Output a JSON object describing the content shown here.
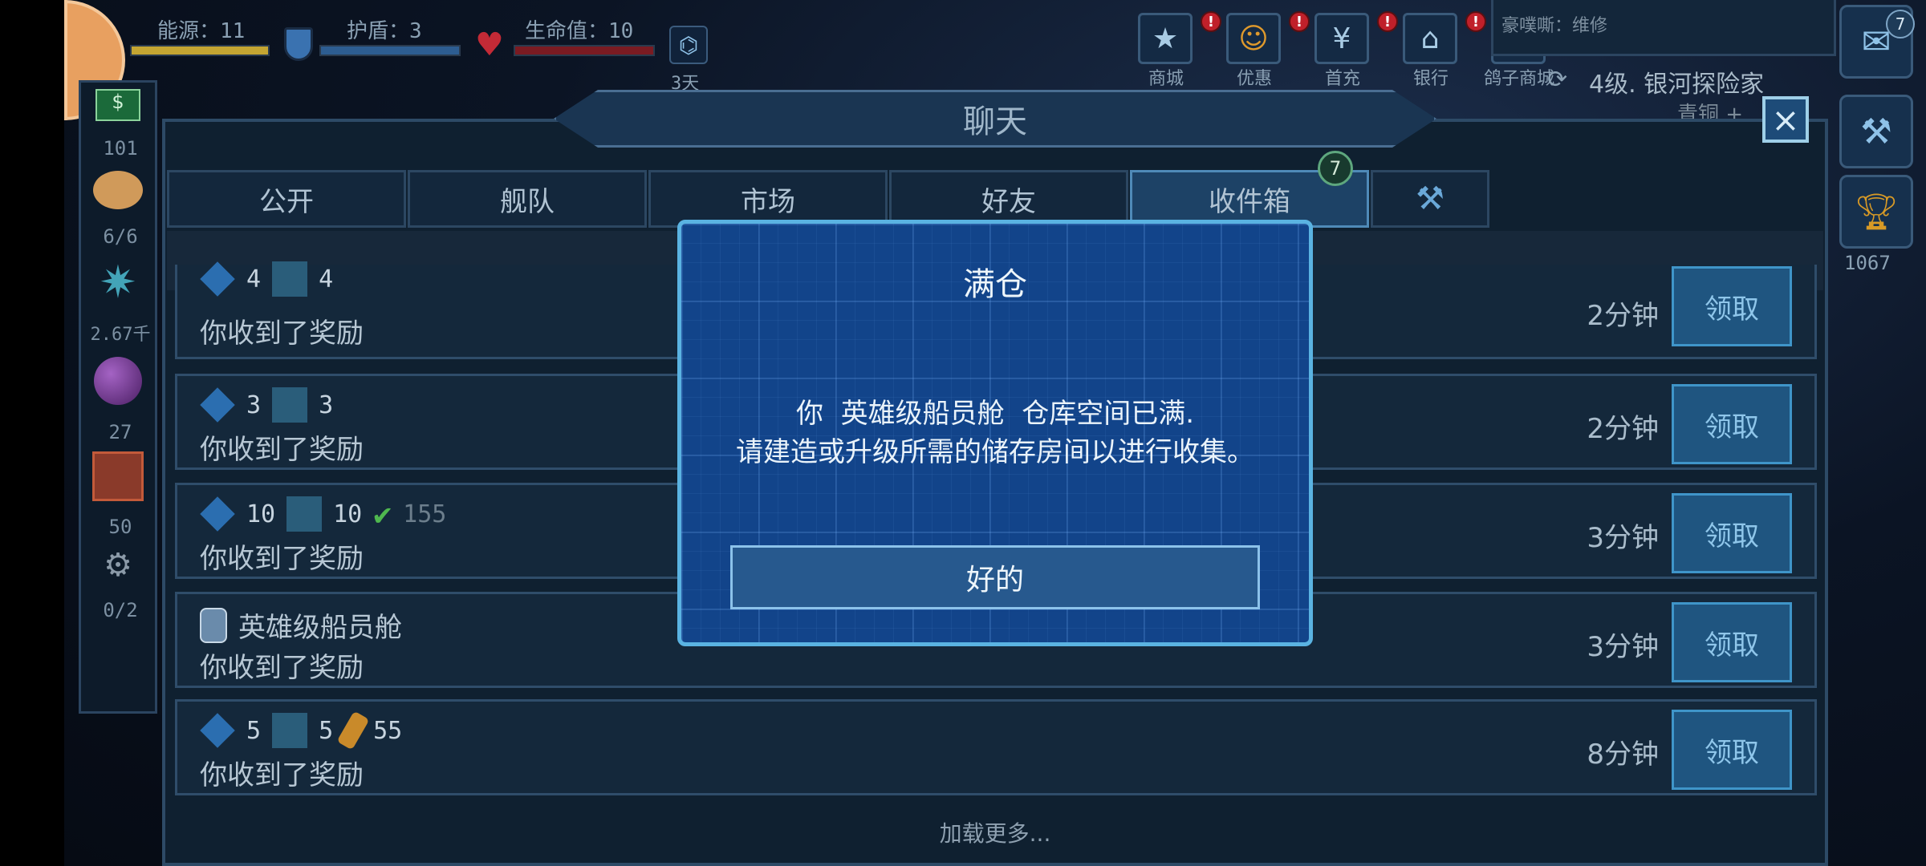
{
  "hud": {
    "energy_label": "能源：11",
    "shield_label": "护盾：3",
    "health_label": "生命值：10",
    "timer_label": "3天",
    "notice_text": "豪噗嘶：维修",
    "rank_text": "4级. 银河探险家",
    "rank_sub": "青铜 +"
  },
  "shop_buttons": [
    {
      "label": "商城",
      "icon": "star-badge-icon",
      "badge": "!"
    },
    {
      "label": "优惠",
      "icon": "offer-icon",
      "badge": "!"
    },
    {
      "label": "首充",
      "icon": "yen-icon",
      "badge": "!"
    },
    {
      "label": "银行",
      "icon": "bank-icon",
      "badge": "!"
    },
    {
      "label": "鸽子商城",
      "icon": "bird-icon",
      "badge": "!"
    }
  ],
  "left_panel": {
    "credits": "101",
    "crew": "6/6",
    "minerals": "2.67千",
    "items": "27",
    "storage": "50",
    "rooms": "0/2"
  },
  "right_side": {
    "chat_badge": "7",
    "trophy_count": "1067"
  },
  "chat": {
    "title": "聊天",
    "close_icon": "×",
    "tabs": [
      "公开",
      "舰队",
      "市场",
      "好友",
      "收件箱"
    ],
    "inbox_badge": "7",
    "rows": [
      {
        "items": [
          "4",
          "4"
        ],
        "message": "你收到了奖励",
        "time": "2分钟",
        "claim": "领取"
      },
      {
        "items": [
          "3",
          "3"
        ],
        "message": "你收到了奖励",
        "time": "2分钟",
        "claim": "领取"
      },
      {
        "items": [
          "10",
          "10",
          "155"
        ],
        "message": "你收到了奖励",
        "time": "3分钟",
        "claim": "领取"
      },
      {
        "item_name": "英雄级船员舱",
        "message": "你收到了奖励",
        "time": "3分钟",
        "claim": "领取"
      },
      {
        "items": [
          "5",
          "5",
          "55"
        ],
        "message": "你收到了奖励",
        "time": "8分钟",
        "claim": "领取"
      }
    ],
    "load_more": "加载更多..."
  },
  "modal": {
    "title": "满仓",
    "message_line1": "你  英雄级船员舱  仓库空间已满.",
    "message_line2": "请建造或升级所需的储存房间以进行收集。",
    "ok_label": "好的"
  }
}
